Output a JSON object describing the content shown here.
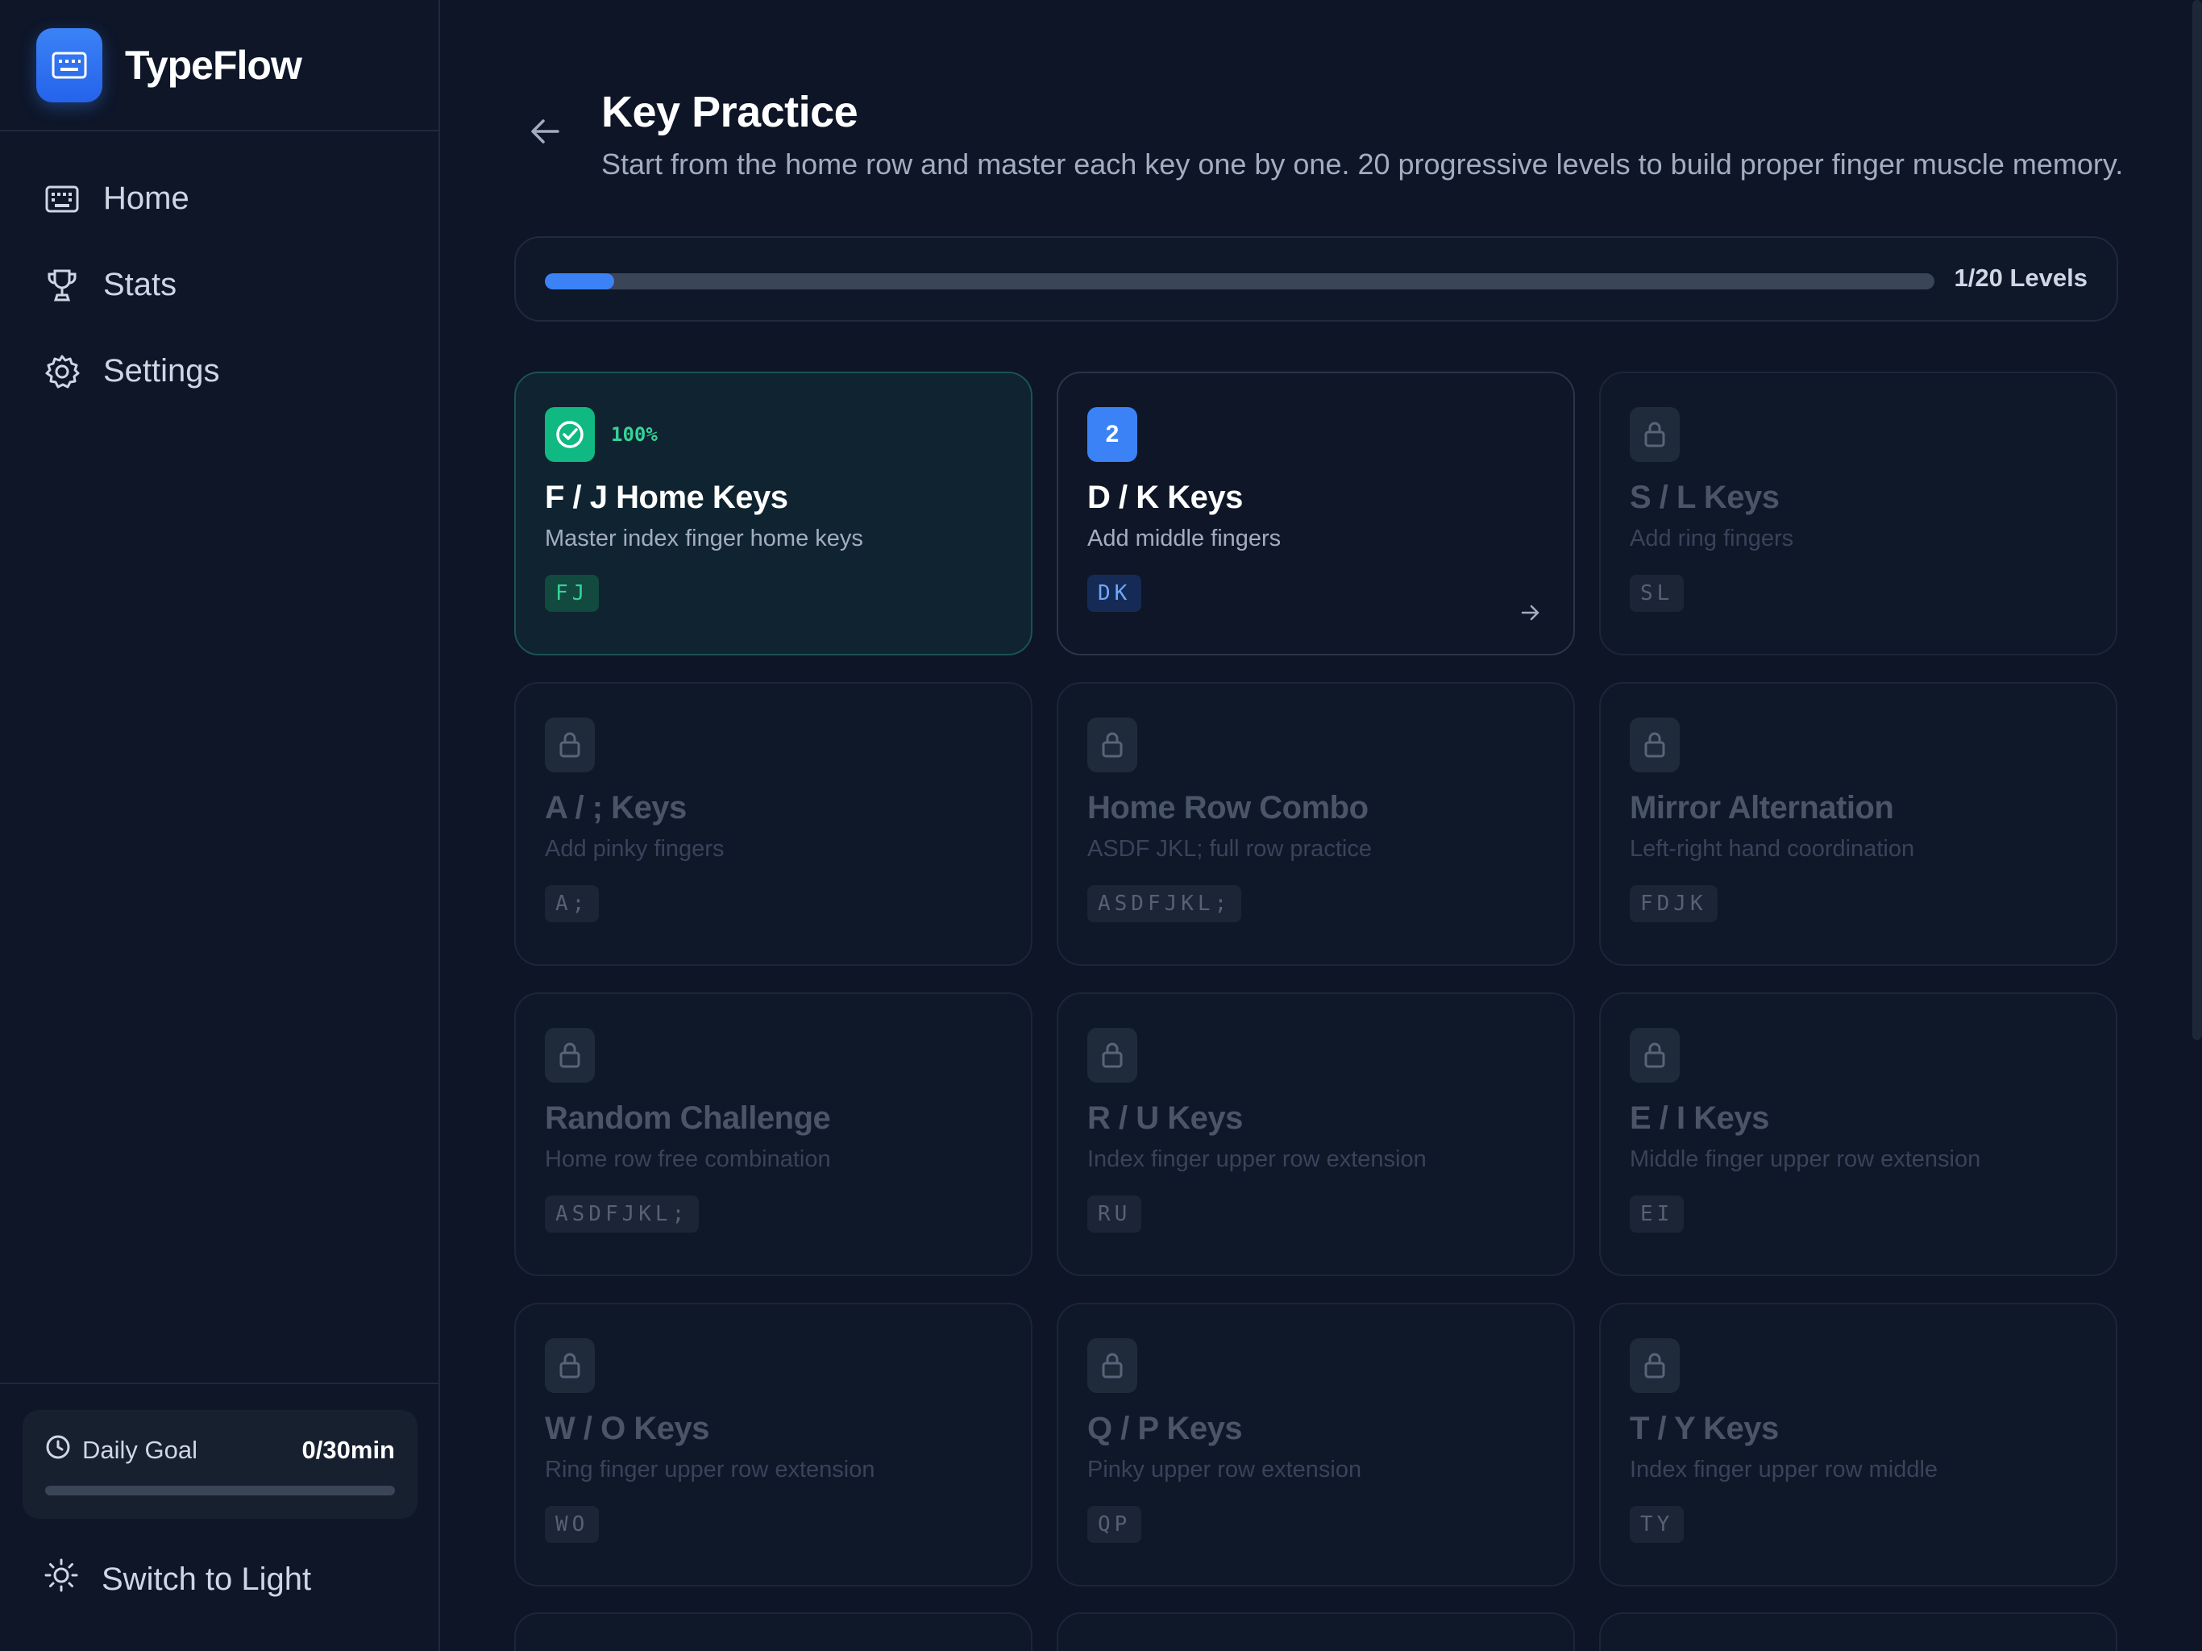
{
  "app": {
    "name": "TypeFlow"
  },
  "nav": [
    {
      "label": "Home",
      "icon": "keyboard-icon"
    },
    {
      "label": "Stats",
      "icon": "trophy-icon"
    },
    {
      "label": "Settings",
      "icon": "gear-icon"
    }
  ],
  "daily_goal": {
    "label": "Daily Goal",
    "value": "0/30min",
    "progress": 0
  },
  "theme_toggle": {
    "label": "Switch to Light"
  },
  "page": {
    "title": "Key Practice",
    "subtitle": "Start from the home row and master each key one by one. 20 progressive levels to build proper finger muscle memory."
  },
  "progress": {
    "completed": 1,
    "total": 20,
    "label": "1/20 Levels"
  },
  "levels": [
    {
      "status": "completed",
      "badge": "",
      "percent": "100%",
      "title": "F / J Home Keys",
      "desc": "Master index finger home keys",
      "keys": "FJ"
    },
    {
      "status": "current",
      "badge": "2",
      "title": "D / K Keys",
      "desc": "Add middle fingers",
      "keys": "DK"
    },
    {
      "status": "locked",
      "title": "S / L Keys",
      "desc": "Add ring fingers",
      "keys": "SL"
    },
    {
      "status": "locked",
      "title": "A / ; Keys",
      "desc": "Add pinky fingers",
      "keys": "A;"
    },
    {
      "status": "locked",
      "title": "Home Row Combo",
      "desc": "ASDF JKL; full row practice",
      "keys": "ASDFJKL;"
    },
    {
      "status": "locked",
      "title": "Mirror Alternation",
      "desc": "Left-right hand coordination",
      "keys": "FDJK"
    },
    {
      "status": "locked",
      "title": "Random Challenge",
      "desc": "Home row free combination",
      "keys": "ASDFJKL;"
    },
    {
      "status": "locked",
      "title": "R / U Keys",
      "desc": "Index finger upper row extension",
      "keys": "RU"
    },
    {
      "status": "locked",
      "title": "E / I Keys",
      "desc": "Middle finger upper row extension",
      "keys": "EI"
    },
    {
      "status": "locked",
      "title": "W / O Keys",
      "desc": "Ring finger upper row extension",
      "keys": "WO"
    },
    {
      "status": "locked",
      "title": "Q / P Keys",
      "desc": "Pinky upper row extension",
      "keys": "QP"
    },
    {
      "status": "locked",
      "title": "T / Y Keys",
      "desc": "Index finger upper row middle",
      "keys": "TY"
    }
  ],
  "colors": {
    "accent": "#3b82f6",
    "success": "#10b981",
    "background": "#0d1526"
  }
}
